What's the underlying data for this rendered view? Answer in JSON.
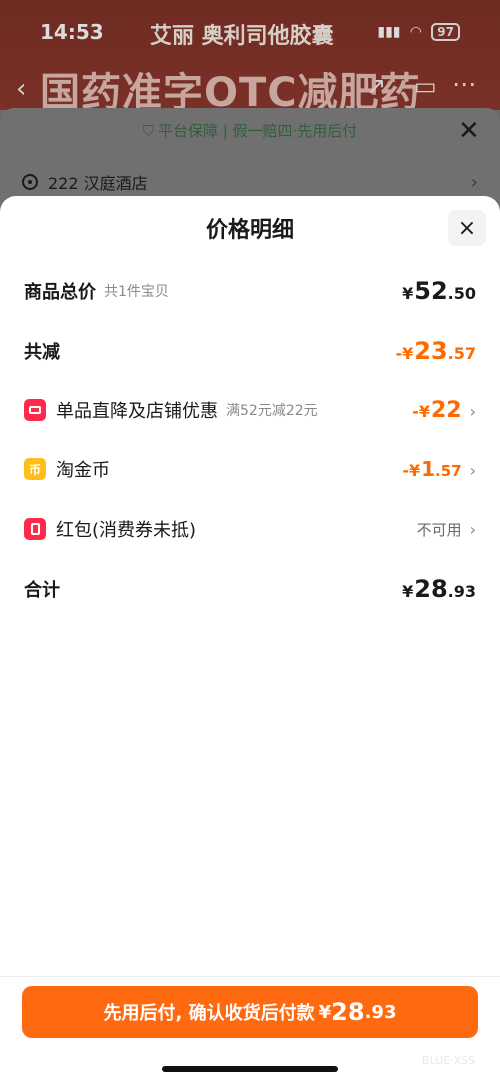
{
  "status_bar": {
    "time": "14:53",
    "battery": "97"
  },
  "background": {
    "brand": "艾丽 奥利司他胶囊",
    "banner": "国药准字OTC减肥药",
    "guarantee": "平台保障 | 假一赔四·先用后付",
    "address": "222 汉庭酒店"
  },
  "modal": {
    "title": "价格明细",
    "close_icon": "×",
    "rows": {
      "total": {
        "label": "商品总价",
        "sub": "共1件宝贝",
        "sym": "¥",
        "int": "52",
        "dec": ".50"
      },
      "discount": {
        "label": "共减",
        "sym": "-¥",
        "int": "23",
        "dec": ".57"
      },
      "store": {
        "label": "单品直降及店铺优惠",
        "sub": "满52元减22元",
        "sym": "-¥",
        "int": "22",
        "dec": ""
      },
      "coins": {
        "label": "淘金币",
        "icon_text": "币",
        "sym": "-¥",
        "int": "1",
        "dec": ".57"
      },
      "redpacket": {
        "label": "红包(消费券未抵)",
        "status": "不可用"
      },
      "sum": {
        "label": "合计",
        "sym": "¥",
        "int": "28",
        "dec": ".93"
      }
    }
  },
  "pay_button": {
    "label": "先用后付, 确认收货后付款",
    "sym": "¥",
    "int": "28",
    "dec": ".93"
  },
  "watermark": "BLUE·XSS",
  "colors": {
    "accent": "#ff6a11",
    "discount": "#ff6a00",
    "red_icon": "#ff2a4a",
    "gold_icon": "#ffbf1a"
  }
}
